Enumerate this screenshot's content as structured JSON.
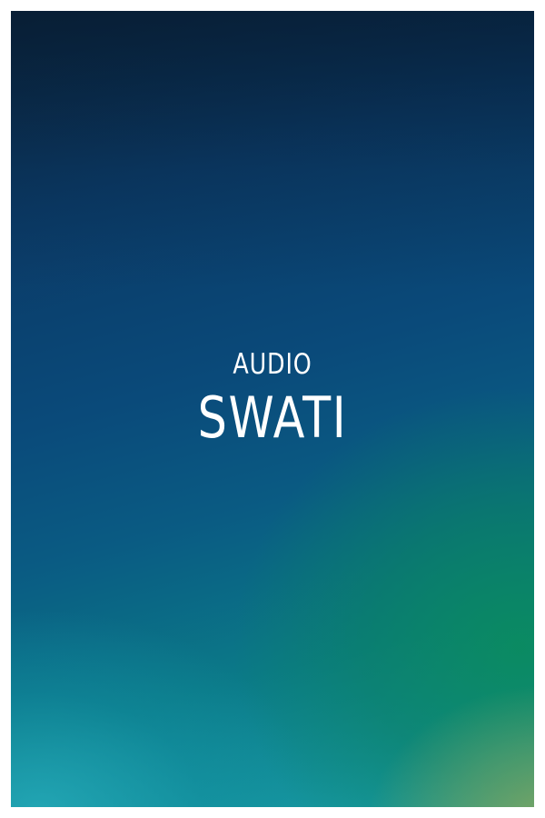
{
  "cover": {
    "subtitle": "AUDIO",
    "title": "SWATI"
  },
  "colors": {
    "border": "#ffffff",
    "gradient_top": "#0c2a46",
    "gradient_mid": "#0a4a7a",
    "gradient_bottom_left": "#1aa0a8",
    "gradient_bottom_right": "#78a868",
    "text": "#ffffff"
  }
}
